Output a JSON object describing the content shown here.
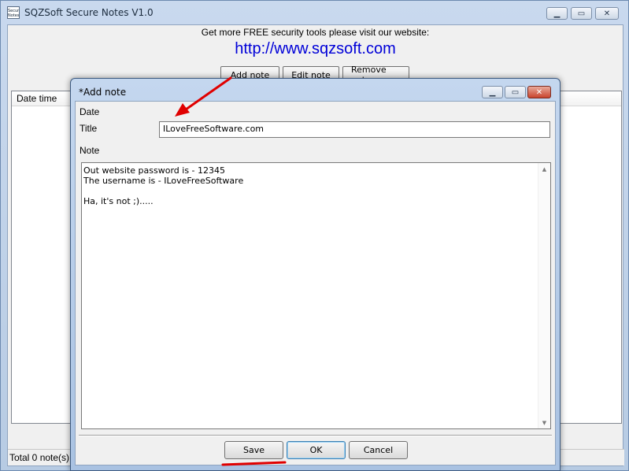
{
  "main_window": {
    "title": "SQZSoft Secure Notes V1.0",
    "icon_text": "Secure Notes",
    "promo_text": "Get more FREE security tools please visit our website:",
    "website_link": "http://www.sqzsoft.com",
    "toolbar": {
      "add_label": "Add note",
      "edit_label": "Edit note",
      "remove_label": "Remove note"
    },
    "list_column": "Date time",
    "status": "Total 0 note(s)"
  },
  "dialog": {
    "title": "*Add note",
    "date_label": "Date",
    "title_label": "Title",
    "title_value": "ILoveFreeSoftware.com",
    "note_label": "Note",
    "note_value": "Out website password is - 12345\nThe username is - ILoveFreeSoftware\n\nHa, it's not ;).....",
    "save_label": "Save",
    "ok_label": "OK",
    "cancel_label": "Cancel"
  },
  "window_buttons": {
    "minimize": "▁",
    "maximize": "▭",
    "close": "✕"
  },
  "scroll_arrows": {
    "up": "▲",
    "down": "▼"
  },
  "colors": {
    "link": "#0000d8",
    "annotation": "#e00000",
    "dialog_close": "#c8442c"
  }
}
